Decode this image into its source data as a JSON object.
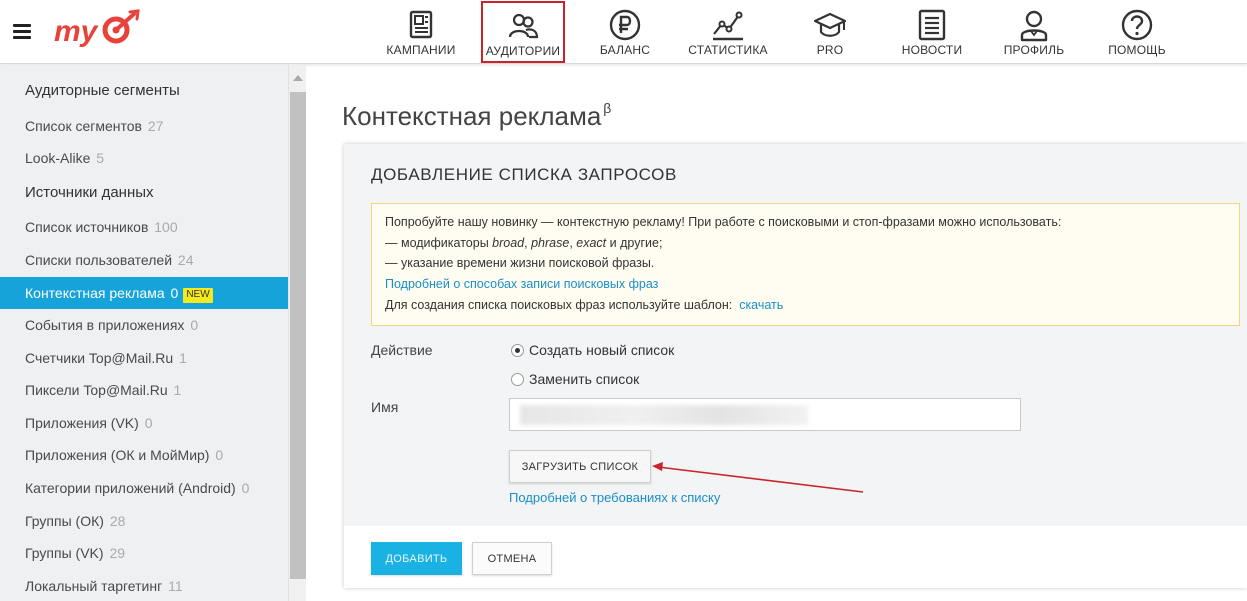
{
  "header": {
    "logo_text": "my",
    "nav": [
      {
        "id": "campaigns",
        "label": "КАМПАНИИ",
        "icon": "campaigns-icon",
        "active": false
      },
      {
        "id": "audiences",
        "label": "АУДИТОРИИ",
        "icon": "audiences-icon",
        "active": true
      },
      {
        "id": "balance",
        "label": "БАЛАНС",
        "icon": "ruble-icon",
        "active": false
      },
      {
        "id": "statistics",
        "label": "СТАТИСТИКА",
        "icon": "chart-icon",
        "active": false
      },
      {
        "id": "pro",
        "label": "PRO",
        "icon": "graduation-cap-icon",
        "active": false
      },
      {
        "id": "news",
        "label": "НОВОСТИ",
        "icon": "newspaper-icon",
        "active": false
      },
      {
        "id": "profile",
        "label": "ПРОФИЛЬ",
        "icon": "user-icon",
        "active": false
      },
      {
        "id": "help",
        "label": "ПОМОЩЬ",
        "icon": "question-icon",
        "active": false
      }
    ],
    "active_color": "#c9242b"
  },
  "sidebar": {
    "heading_segments": "Аудиторные сегменты",
    "heading_sources": "Источники данных",
    "segment_items": [
      {
        "label": "Список сегментов",
        "count": "27"
      },
      {
        "label": "Look-Alike",
        "count": "5"
      }
    ],
    "source_items": [
      {
        "label": "Список источников",
        "count": "100"
      },
      {
        "label": "Списки пользователей",
        "count": "24"
      },
      {
        "label": "Контекстная реклама",
        "count": "0",
        "badge": "NEW",
        "active": true
      },
      {
        "label": "События в приложениях",
        "count": "0"
      },
      {
        "label": "Счетчики Top@Mail.Ru",
        "count": "1"
      },
      {
        "label": "Пиксели Top@Mail.Ru",
        "count": "1"
      },
      {
        "label": "Приложения (VK)",
        "count": "0"
      },
      {
        "label": "Приложения (ОК и МойМир)",
        "count": "0"
      },
      {
        "label": "Категории приложений (Android)",
        "count": "0"
      },
      {
        "label": "Группы (ОК)",
        "count": "28"
      },
      {
        "label": "Группы (VK)",
        "count": "29"
      },
      {
        "label": "Локальный таргетинг",
        "count": "11"
      }
    ],
    "active_color": "#16a3da"
  },
  "main": {
    "title": "Контекстная реклама",
    "title_sup": "β",
    "card_title": "ДОБАВЛЕНИЕ СПИСКА ЗАПРОСОВ",
    "info": {
      "line1": "Попробуйте нашу новинку — контекстную рекламу! При работе с поисковыми и стоп-фразами можно использовать:",
      "line2_prefix": "— модификаторы ",
      "line2_broad": "broad",
      "line2_sep1": ", ",
      "line2_phrase": "phrase",
      "line2_sep2": ", ",
      "line2_exact": "exact",
      "line2_suffix": " и другие;",
      "line3": "— указание времени жизни поисковой фразы.",
      "link_more": "Подробней о способах записи поисковых фраз",
      "template_text": "Для создания списка поисковых фраз используйте шаблон:",
      "template_link": "скачать"
    },
    "form": {
      "action_label": "Действие",
      "radio_create": "Создать новый список",
      "radio_replace": "Заменить список",
      "selected": "create",
      "name_label": "Имя",
      "name_value": "",
      "upload_button": "ЗАГРУЗИТЬ СПИСОК",
      "requirements_link": "Подробней о требованиях к списку"
    },
    "footer": {
      "add_button": "ДОБАВИТЬ",
      "cancel_button": "ОТМЕНА"
    }
  }
}
